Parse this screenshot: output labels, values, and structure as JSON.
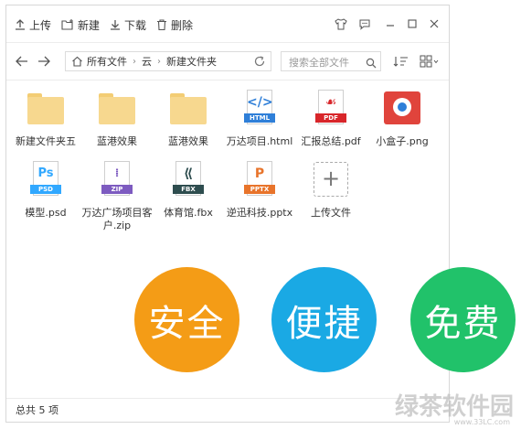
{
  "toolbar": {
    "upload": "上传",
    "new": "新建",
    "download": "下载",
    "delete": "删除"
  },
  "address": {
    "crumbs": [
      "所有文件",
      "云",
      "新建文件夹"
    ],
    "search_placeholder": "搜索全部文件"
  },
  "files": [
    {
      "name": "新建文件夹五",
      "type": "folder"
    },
    {
      "name": "蓝港效果",
      "type": "folder"
    },
    {
      "name": "蓝港效果",
      "type": "folder"
    },
    {
      "name": "万达项目.html",
      "type": "html",
      "label": "HTML",
      "color": "#2f7fd8"
    },
    {
      "name": "汇报总结.pdf",
      "type": "pdf",
      "label": "PDF",
      "color": "#d8262a"
    },
    {
      "name": "小盒子.png",
      "type": "png",
      "color": "#e0443c"
    },
    {
      "name": "模型.psd",
      "type": "psd",
      "label": "PSD",
      "color": "#31a8ff"
    },
    {
      "name": "万达广场项目客户.zip",
      "type": "zip",
      "label": "ZIP",
      "color": "#7d5bc0"
    },
    {
      "name": "体育馆.fbx",
      "type": "fbx",
      "label": "FBX",
      "color": "#2e4d4f"
    },
    {
      "name": "逆迅科技.pptx",
      "type": "pptx",
      "label": "PPTX",
      "color": "#e8742b"
    }
  ],
  "upload_tile": "上传文件",
  "status": "总共 5 项",
  "badges": [
    {
      "text": "安全",
      "color": "#f49c16"
    },
    {
      "text": "便捷",
      "color": "#1aa9e4"
    },
    {
      "text": "免费",
      "color": "#21c26a"
    }
  ],
  "watermark": {
    "text": "绿茶软件园",
    "url": "www.33LC.com"
  }
}
